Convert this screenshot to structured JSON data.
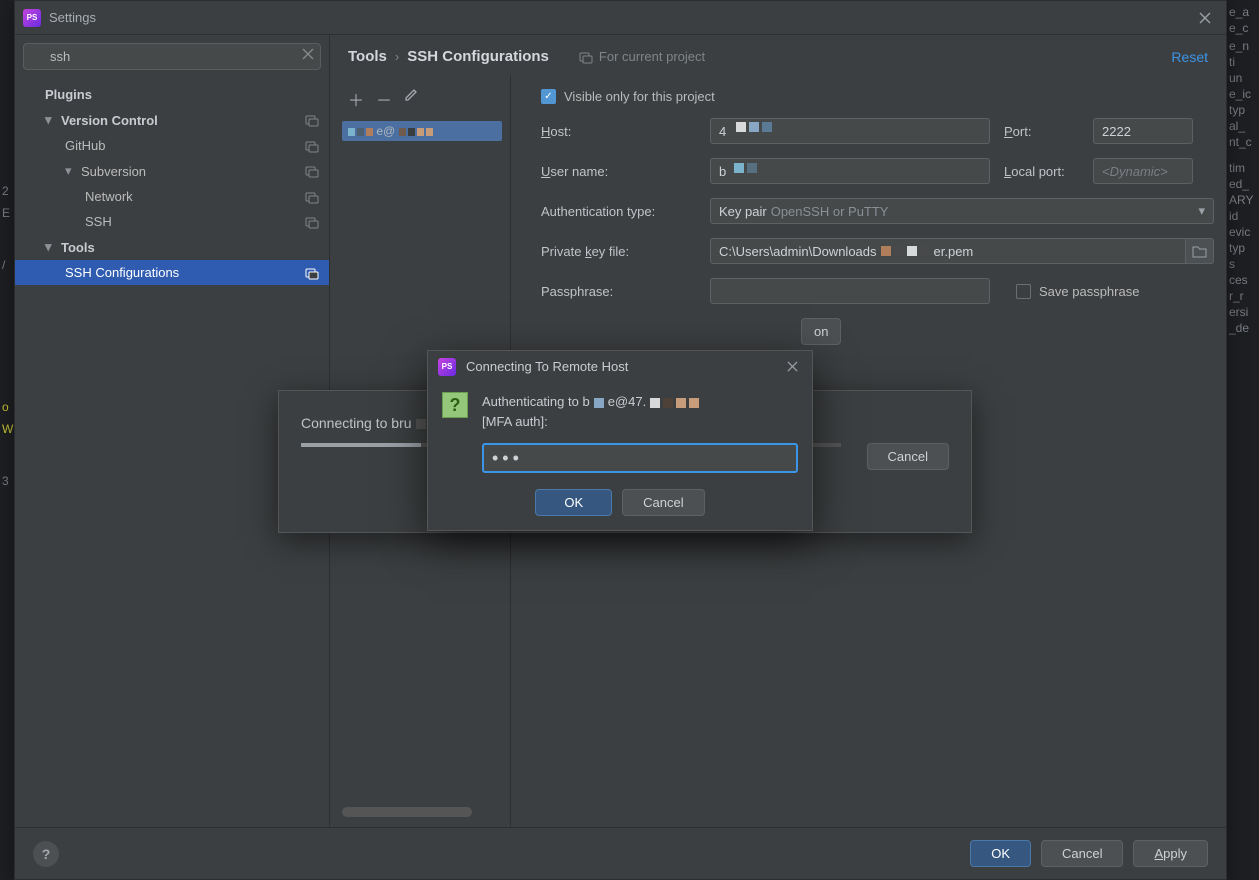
{
  "window": {
    "title": "Settings",
    "reset": "Reset"
  },
  "search": {
    "value": "ssh"
  },
  "tree": {
    "plugins": "Plugins",
    "version_control": "Version Control",
    "github": "GitHub",
    "subversion": "Subversion",
    "network": "Network",
    "ssh": "SSH",
    "tools": "Tools",
    "ssh_configs": "SSH Configurations"
  },
  "breadcrumb": {
    "tools": "Tools",
    "ssh_cfg": "SSH Configurations",
    "for_proj": "For current project"
  },
  "form": {
    "visible_only": "Visible only for this project",
    "host_label": "ost:",
    "host_value": "4",
    "port_label": "ort:",
    "port_value": "2222",
    "user_label": "ser name:",
    "user_value": "b",
    "localport_label": "ocal port:",
    "localport_placeholder": "<Dynamic>",
    "authtype_label": "Authentication type:",
    "authtype_value": "Key pair",
    "authtype_hint": "OpenSSH or PuTTY",
    "privkey_label": "Private ",
    "privkey_label2": "ey file:",
    "privkey_value_a": "C:\\Users\\admin\\Downloads",
    "privkey_value_b": "er.pem",
    "pass_label": "Passphrase:",
    "save_pass": "Save passphrase",
    "clipped_btn": "on"
  },
  "config_item": "e@",
  "progress": {
    "text": "Connecting to bru",
    "cancel": "Cancel"
  },
  "auth": {
    "title": "Connecting To Remote Host",
    "line1_a": "Authenticating to b",
    "line1_b": "e@47.",
    "line2": "[MFA auth]:",
    "value": "•••",
    "ok": "OK",
    "cancel": "Cancel"
  },
  "footer": {
    "ok": "OK",
    "cancel": "Cancel",
    "apply": "pply"
  },
  "bg_lines": [
    "e_a",
    "e_c",
    "",
    "e_n",
    "ti",
    "un",
    "e_ic",
    "typ",
    "al_",
    "nt_c",
    "",
    "",
    "",
    "",
    "",
    "tim",
    "ed_",
    "ARY",
    "id",
    "evic",
    "typ",
    "s",
    "ces",
    "r_r",
    "ersi",
    "_de"
  ]
}
